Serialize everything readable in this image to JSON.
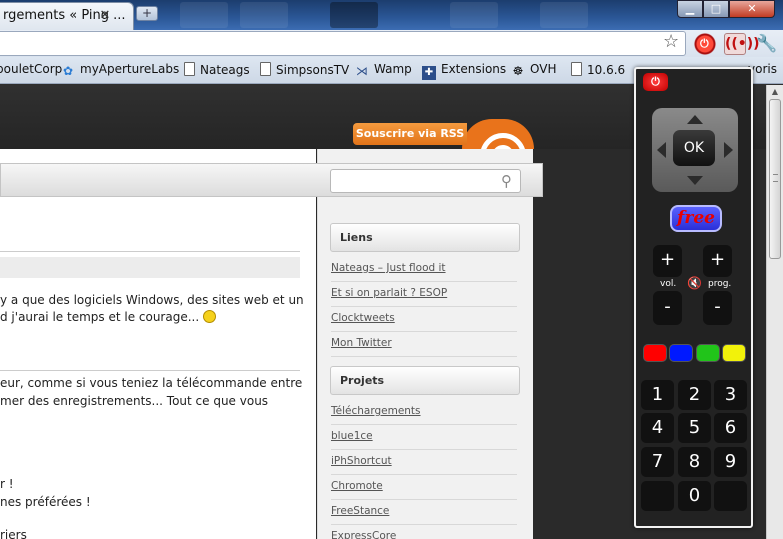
{
  "tab": {
    "title": "rgements « Ping ..."
  },
  "window_controls": {
    "minimize": "▁",
    "maximize": "□",
    "close": "✕"
  },
  "bookmarks": [
    {
      "label": "bouletCorp",
      "icon": "page-icon"
    },
    {
      "label": "myApertureLabs",
      "icon": "aperture-icon"
    },
    {
      "label": "Nateags",
      "icon": "page-icon"
    },
    {
      "label": "SimpsonsTV",
      "icon": "page-icon"
    },
    {
      "label": "Wamp",
      "icon": "wamp-icon"
    },
    {
      "label": "Extensions",
      "icon": "puzzle-icon"
    },
    {
      "label": "OVH",
      "icon": "ovh-icon"
    },
    {
      "label": "10.6.6",
      "icon": "page-icon"
    },
    {
      "label": "voris",
      "icon": "page-icon"
    }
  ],
  "page": {
    "rss_label": "Souscrire via RSS",
    "post_lines": [
      "y a que des logiciels Windows, des sites web et un",
      "d j'aurai le temps et le courage...",
      "eur, comme si vous teniez la télécommande entre",
      "mer des enregistrements... Tout ce que vous",
      "r !",
      "nes préférées !",
      "riers"
    ],
    "sidebar": {
      "liens_title": "Liens",
      "liens": [
        "Nateags – Just flood it",
        "Et si on parlait ? ESOP",
        "Clocktweets",
        "Mon Twitter"
      ],
      "projets_title": "Projets",
      "projets": [
        "Téléchargements",
        "blue1ce",
        "iPhShortcut",
        "Chromote",
        "FreeStance",
        "ExpressCore"
      ]
    }
  },
  "remote": {
    "ok_label": "OK",
    "free_label": "free",
    "vol_label": "vol.",
    "prog_label": "prog.",
    "plus": "+",
    "minus": "-",
    "color_buttons": [
      "#ff0000",
      "#0019ff",
      "#21c41a",
      "#f2f20a"
    ],
    "numbers": [
      "1",
      "2",
      "3",
      "4",
      "5",
      "6",
      "7",
      "8",
      "9",
      "",
      "0",
      ""
    ]
  },
  "colors": {
    "rss_orange": "#e9731b",
    "remote_bg": "#222222"
  }
}
